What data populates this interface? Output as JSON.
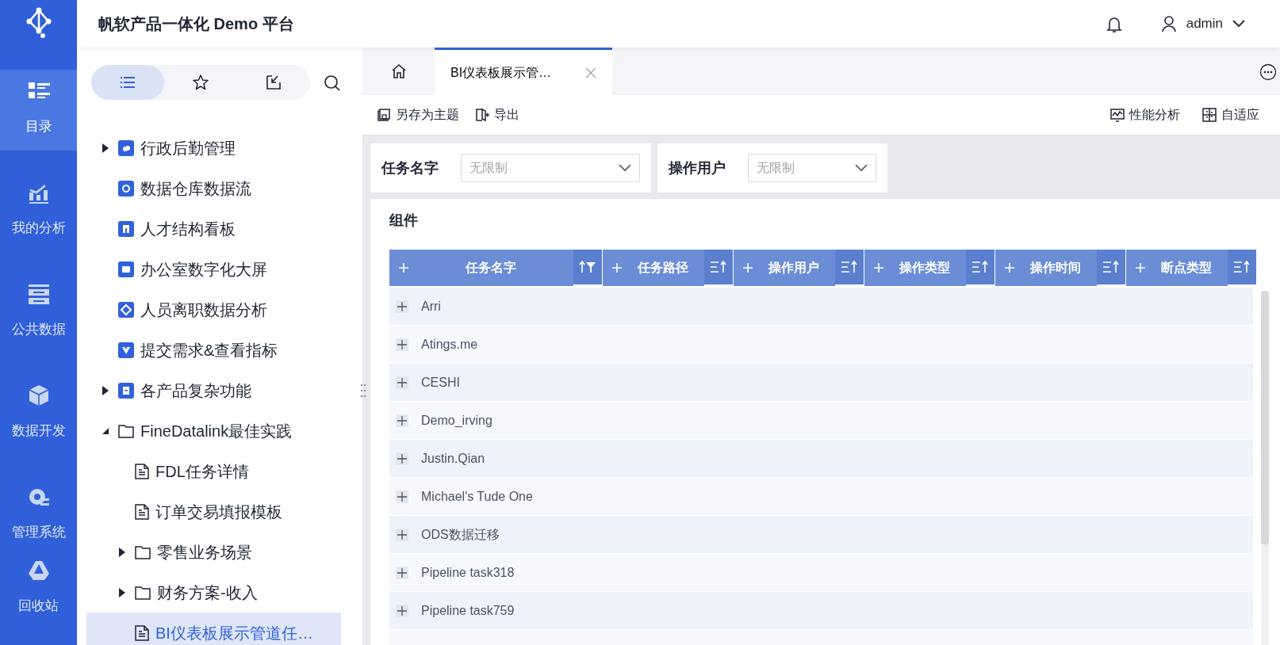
{
  "header": {
    "title": "帆软产品一体化 Demo 平台",
    "user": "admin"
  },
  "nav": [
    {
      "label": "目录",
      "selected": true
    },
    {
      "label": "我的分析",
      "selected": false
    },
    {
      "label": "公共数据",
      "selected": false
    },
    {
      "label": "数据开发",
      "selected": false
    },
    {
      "label": "管理系统",
      "selected": false
    }
  ],
  "nav_bottom": {
    "label": "回收站",
    "selected": false
  },
  "sidebar_tabs": [
    {
      "selected": true
    },
    {
      "selected": false
    },
    {
      "selected": false
    }
  ],
  "tree": [
    {
      "kind": "app",
      "label": "行政后勤管理",
      "expanded": false,
      "selected": false
    },
    {
      "kind": "app",
      "label": "数据仓库数据流",
      "selected": false
    },
    {
      "kind": "app",
      "label": "人才结构看板",
      "selected": false
    },
    {
      "kind": "app",
      "label": "办公室数字化大屏",
      "selected": false
    },
    {
      "kind": "app",
      "label": "人员离职数据分析",
      "selected": false
    },
    {
      "kind": "app",
      "label": "提交需求&查看指标",
      "selected": false
    },
    {
      "kind": "app",
      "label": "各产品复杂功能",
      "expanded": false,
      "selected": false
    },
    {
      "kind": "folder",
      "label": "FineDatalink最佳实践",
      "expanded": true,
      "selected": false,
      "children": [
        {
          "kind": "doc",
          "label": "FDL任务详情",
          "selected": false
        },
        {
          "kind": "doc",
          "label": "订单交易填报模板",
          "selected": false
        },
        {
          "kind": "folder",
          "label": "零售业务场景",
          "expanded": false,
          "selected": false
        },
        {
          "kind": "folder",
          "label": "财务方案-收入",
          "expanded": false,
          "selected": false
        },
        {
          "kind": "doc",
          "label": "BI仪表板展示管道任…",
          "selected": true
        }
      ]
    }
  ],
  "tabs": [
    {
      "kind": "home"
    },
    {
      "kind": "page",
      "label": "BI仪表板展示管…",
      "selected": true
    }
  ],
  "toolbar": {
    "left": [
      "另存为主题",
      "导出"
    ],
    "right": [
      "性能分析",
      "自适应"
    ]
  },
  "filters": [
    {
      "label": "任务名字",
      "placeholder": "无限制"
    },
    {
      "label": "操作用户",
      "placeholder": "无限制"
    }
  ],
  "widget": {
    "title": "组件",
    "columns": [
      {
        "label": "任务名字",
        "kind": "filtered"
      },
      {
        "label": "任务路径",
        "kind": "sortable"
      },
      {
        "label": "操作用户",
        "kind": "sortable"
      },
      {
        "label": "操作类型",
        "kind": "sortable"
      },
      {
        "label": "操作时间",
        "kind": "sortable"
      },
      {
        "label": "断点类型",
        "kind": "sortable"
      }
    ],
    "rows": [
      "Arri",
      "Atings.me",
      "CESHI",
      "Demo_irving",
      "Justin.Qian",
      "Michael's Tude One",
      "ODS数据迁移",
      "Pipeline task318",
      "Pipeline task759"
    ]
  }
}
